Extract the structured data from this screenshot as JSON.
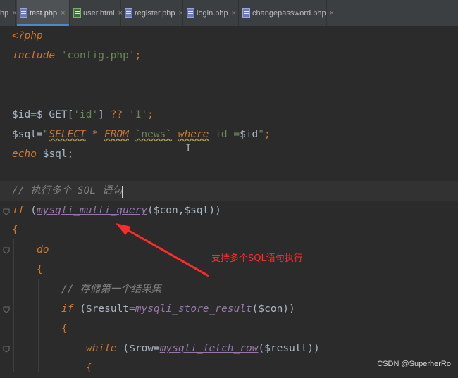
{
  "tabs": [
    {
      "label": "hp",
      "close": "×",
      "active": false
    },
    {
      "label": "test.php",
      "close": "×",
      "active": true
    },
    {
      "label": "user.html",
      "close": "×",
      "active": false
    },
    {
      "label": "register.php",
      "close": "×",
      "active": false
    },
    {
      "label": "login.php",
      "close": "×",
      "active": false
    },
    {
      "label": "changepassword.php",
      "close": "×",
      "active": false
    }
  ],
  "code": {
    "l1": "<?php",
    "l2_kw": "include",
    "l2_str": "'config.php'",
    "l2_end": ";",
    "l5_a": "$id=$_GET[",
    "l5_s1": "'id'",
    "l5_b": "] ",
    "l5_op": "??",
    "l5_s2": "'1'",
    "l5_end": ";",
    "l6_a": "$sql=",
    "l6_q": "\"",
    "l6_k1": "SELECT",
    "l6_star": " * ",
    "l6_k2": "FROM",
    "l6_tbl": "`news`",
    "l6_k3": "where",
    "l6_col": "id",
    "l6_eq": " =",
    "l6_var": "$id",
    "l6_q2": "\"",
    "l6_end": ";",
    "l7_kw": "echo",
    "l7_rest": " $sql;",
    "l9_cmt": "// 执行多个 SQL 语句",
    "l10_kw": "if",
    "l10_a": " (",
    "l10_fn": "mysqli_multi_query",
    "l10_b": "($con,$sql))",
    "l11": "{",
    "l12_kw": "do",
    "l13": "{",
    "l14_cmt": "// 存储第一个结果集",
    "l15_kw": "if",
    "l15_a": " ($result=",
    "l15_fn": "mysqli_store_result",
    "l15_b": "($con))",
    "l16": "{",
    "l17_kw": "while",
    "l17_a": " ($row=",
    "l17_fn": "mysqli_fetch_row",
    "l17_b": "($result))",
    "l18": "{"
  },
  "annotation": "支持多个SQL语句执行",
  "watermark": "CSDN @SuperherRo",
  "colors": {
    "annotation": "#ff2b2b",
    "keyword": "#cc7832",
    "string": "#6a8759",
    "function": "#9876aa"
  }
}
